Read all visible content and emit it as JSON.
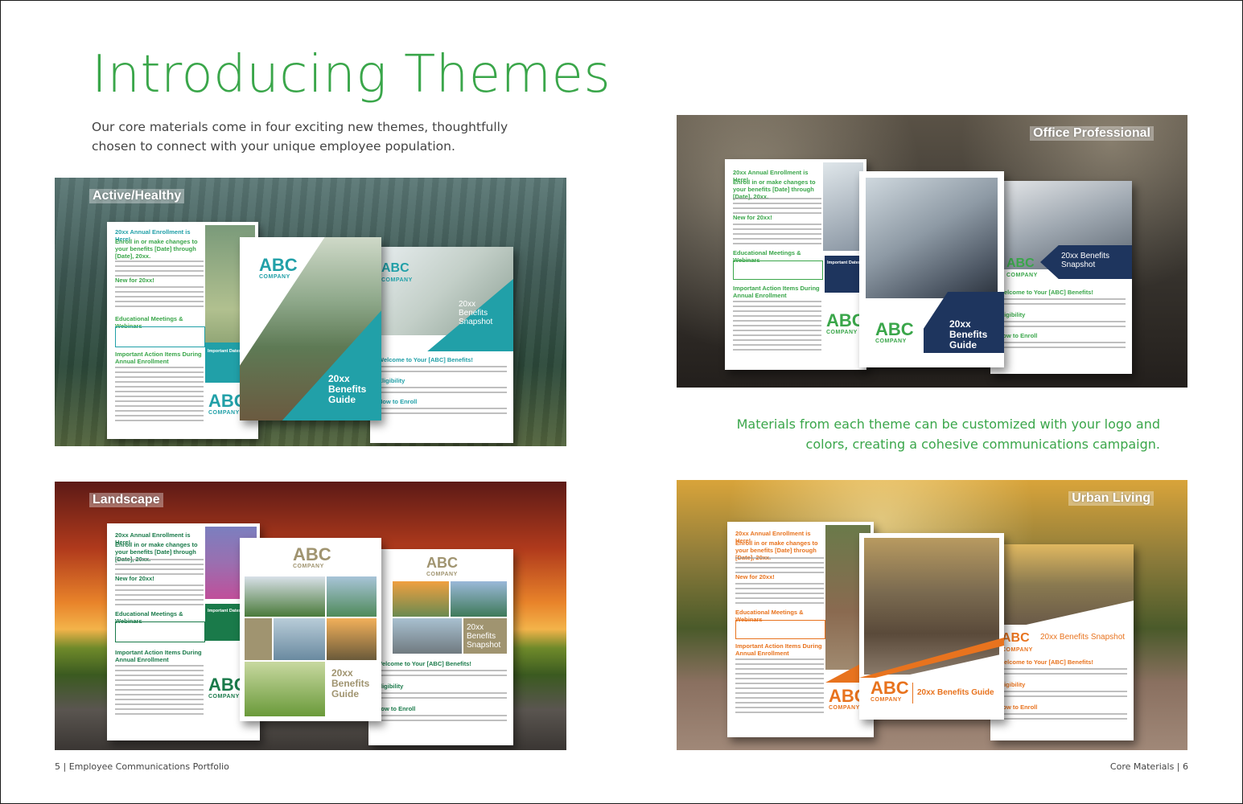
{
  "header": {
    "title": "Introducing Themes",
    "intro": "Our core materials come in four exciting new themes, thoughtfully chosen to connect with your unique employee population."
  },
  "note": "Materials from each theme can be customized with your logo and colors, creating a cohesive communications campaign.",
  "footer": {
    "left": "5  |  Employee Communications Portfolio",
    "right": "Core Materials  |  6"
  },
  "common": {
    "enrollment_heading": "20xx Annual Enrollment is Here!",
    "enrollment_sub": "Enroll in or make changes to your benefits [Date] through [Date], 20xx.",
    "new_for": "New for 20xx!",
    "meetings": "Educational Meetings & Webinars",
    "action_items": "Important Action Items During Annual Enrollment",
    "important_dates": "Important Dates",
    "welcome": "Welcome to Your [ABC] Benefits!",
    "eligibility": "Eligibility",
    "how_to_enroll": "How to Enroll",
    "abc": "ABC",
    "company": "COMPANY",
    "guide_title": "20xx Benefits Guide",
    "snapshot_title": "20xx Benefits Snapshot"
  },
  "themes": [
    {
      "label": "Active/Healthy",
      "color": "#21a0a8"
    },
    {
      "label": "Office Professional",
      "color": "#1e355e"
    },
    {
      "label": "Landscape",
      "color": "#a09470"
    },
    {
      "label": "Urban Living",
      "color": "#e8731e"
    }
  ],
  "colors": {
    "brand_green": "#3aa64a",
    "text_gray": "#444444"
  }
}
